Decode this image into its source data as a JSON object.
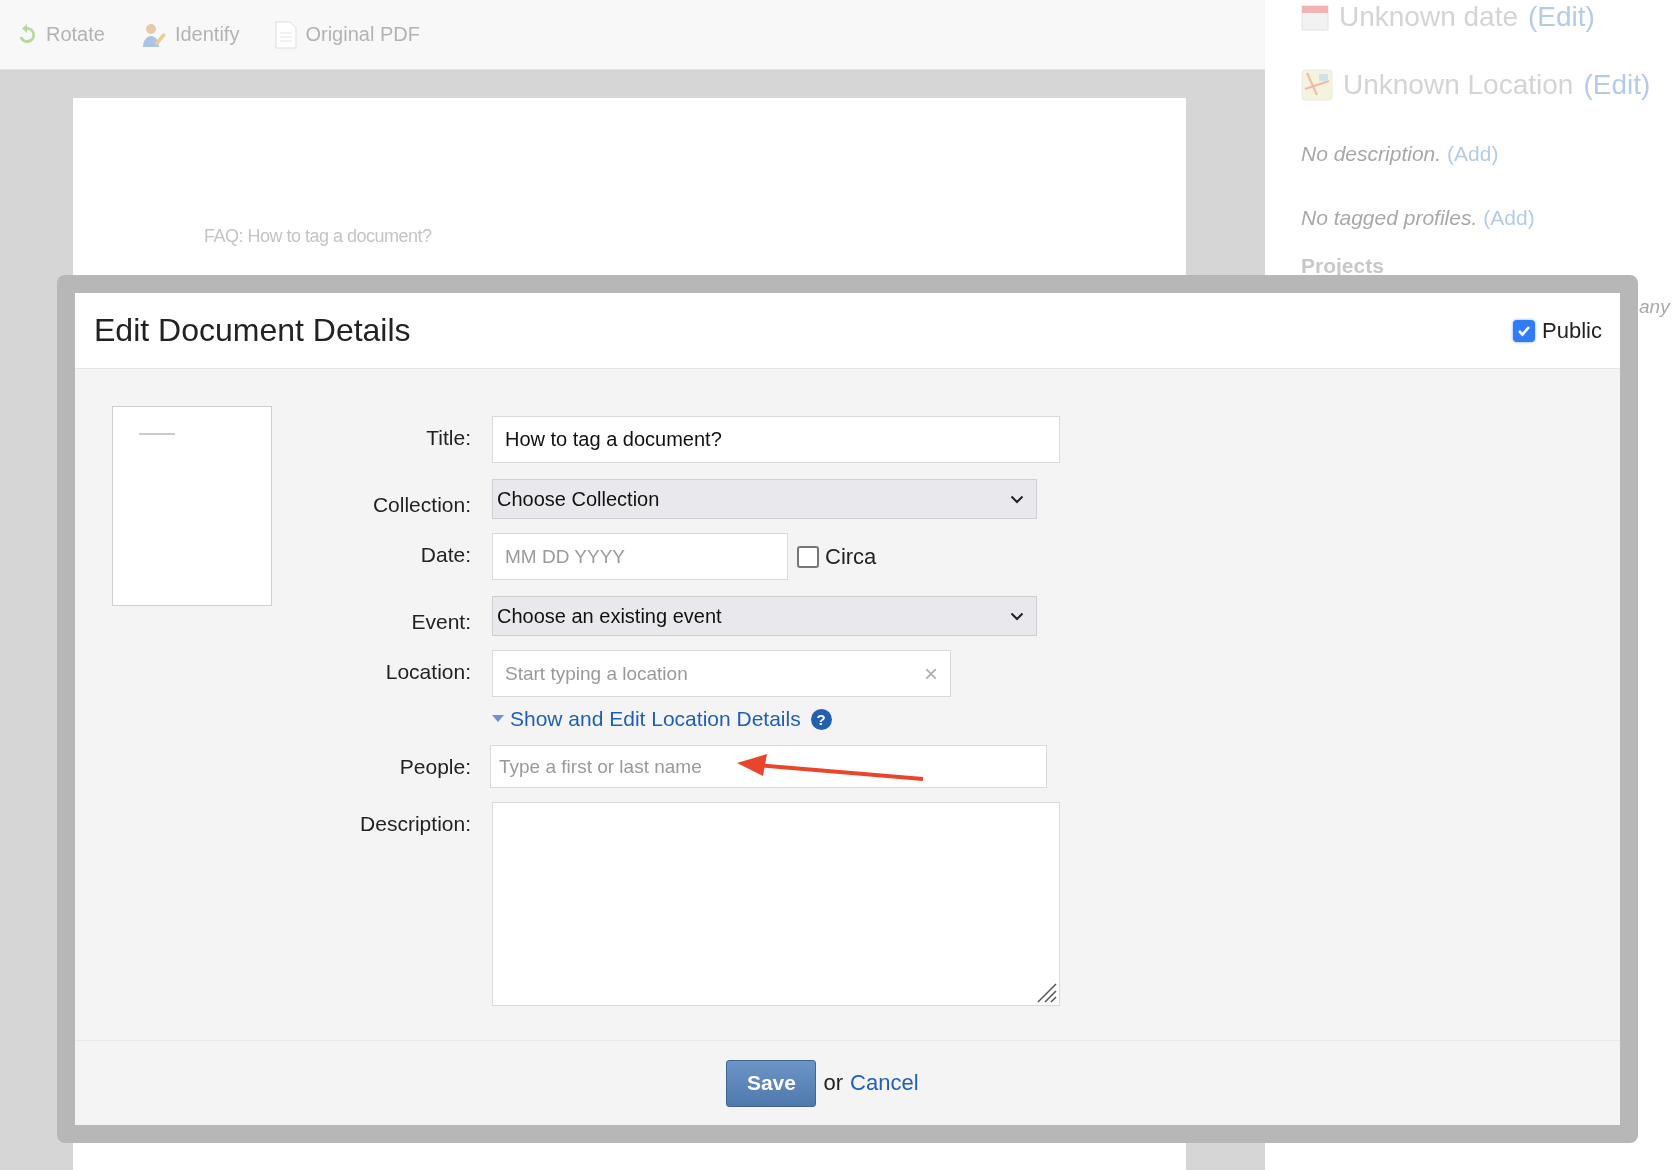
{
  "toolbar": [
    {
      "kind": "rotate",
      "label": "Rotate"
    },
    {
      "kind": "identify",
      "label": "Identify"
    },
    {
      "kind": "pdf",
      "label": "Original PDF"
    }
  ],
  "document_page": {
    "text": "FAQ: How to tag a document?"
  },
  "side_panel": {
    "date": {
      "text": "Unknown date",
      "link": "(Edit)"
    },
    "location": {
      "text": "Unknown Location",
      "link": "(Edit)"
    },
    "description": {
      "text": "No description.",
      "link": "(Add)"
    },
    "profiles": {
      "text": "No tagged profiles.",
      "link": "(Add)"
    },
    "projects_heading": "Projects",
    "cut_text": "any"
  },
  "dialog": {
    "title": "Edit Document Details",
    "public": {
      "label": "Public",
      "checked": true
    },
    "fields": [
      {
        "kind": "text",
        "label": "Title:",
        "value": "How to tag a document?"
      },
      {
        "kind": "select",
        "label": "Collection:",
        "value": "Choose Collection"
      },
      {
        "kind": "date",
        "label": "Date:",
        "placeholder": "MM DD YYYY",
        "circa": {
          "label": "Circa",
          "checked": false
        }
      },
      {
        "kind": "select",
        "label": "Event:",
        "value": "Choose an existing event"
      },
      {
        "kind": "location",
        "label": "Location:",
        "placeholder": "Start typing a location",
        "clear": "×",
        "details_link": "Show and Edit Location Details",
        "help": "?"
      },
      {
        "kind": "people",
        "label": "People:",
        "placeholder": "Type a first or last name"
      },
      {
        "kind": "textarea",
        "label": "Description:"
      }
    ],
    "save": "Save",
    "or": "or",
    "cancel": "Cancel"
  }
}
